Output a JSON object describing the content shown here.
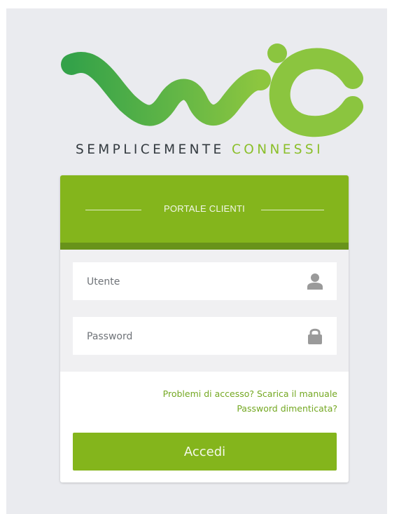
{
  "brand": {
    "tagline_part1": "SEMPLICEMENTE",
    "tagline_part2": "CONNESSI",
    "accent_color": "#84b51c",
    "logo_green_dark": "#36a64a",
    "logo_green_light": "#8bc53f"
  },
  "login": {
    "header_title": "PORTALE CLIENTI",
    "username_placeholder": "Utente",
    "password_placeholder": "Password",
    "username_icon": "user-icon",
    "password_icon": "lock-icon",
    "manual_link": "Problemi di accesso? Scarica il manuale",
    "forgot_link": "Password dimenticata?",
    "submit_label": "Accedi"
  }
}
